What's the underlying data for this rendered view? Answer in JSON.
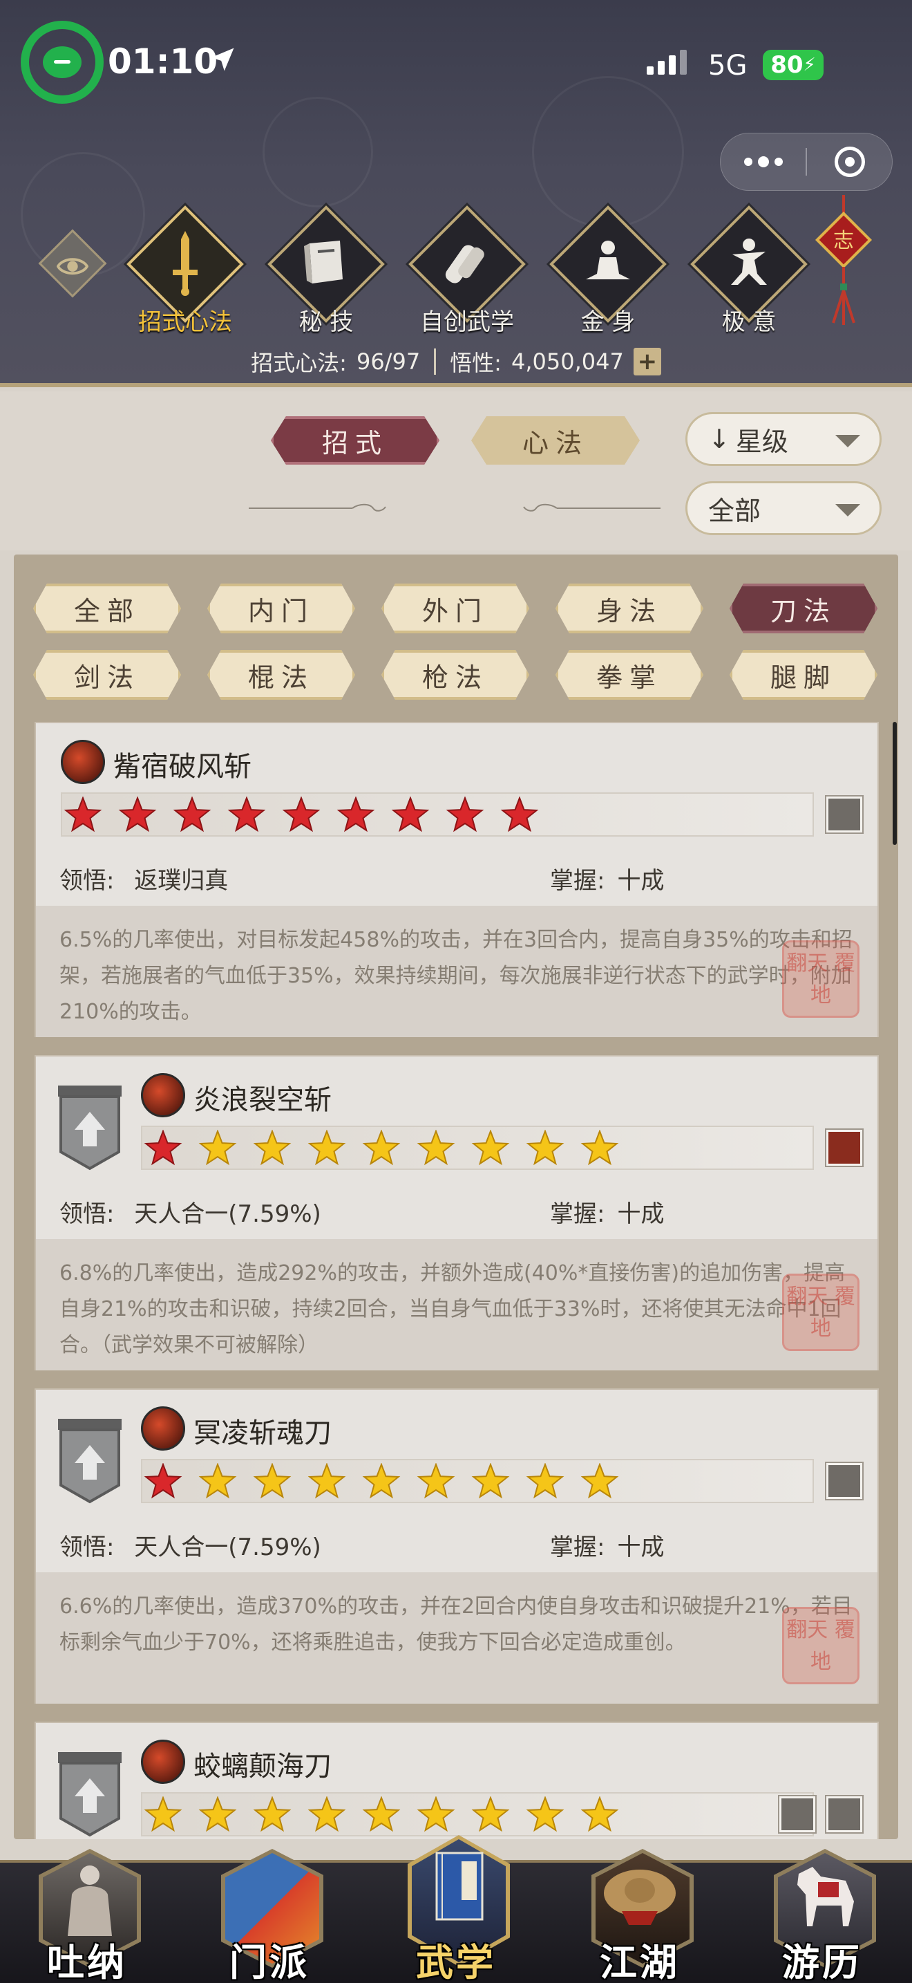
{
  "status": {
    "time": "01:10",
    "network": "5G",
    "battery": "80"
  },
  "top_tabs": [
    {
      "label": "招式心法",
      "icon": "sword-icon",
      "active": true
    },
    {
      "label": "秘 技",
      "icon": "book-icon",
      "active": false
    },
    {
      "label": "自创武学",
      "icon": "scroll-icon",
      "active": false
    },
    {
      "label": "金 身",
      "icon": "meditation-icon",
      "active": false
    },
    {
      "label": "极 意",
      "icon": "martial-stance-icon",
      "active": false
    }
  ],
  "knot_char": "志",
  "stats": {
    "moves_label": "招式心法:",
    "moves_value": "96/97",
    "insight_label": "悟性:",
    "insight_value": "4,050,047",
    "plus": "+"
  },
  "mode_tabs": {
    "zhaoshi": "招式",
    "xinfa": "心法"
  },
  "sort": {
    "label": "星级",
    "arrow": "↓"
  },
  "scope": {
    "label": "全部"
  },
  "filters": [
    {
      "label": "全部",
      "active": false
    },
    {
      "label": "内门",
      "active": false
    },
    {
      "label": "外门",
      "active": false
    },
    {
      "label": "身法",
      "active": false
    },
    {
      "label": "刀法",
      "active": true
    },
    {
      "label": "剑法",
      "active": false
    },
    {
      "label": "棍法",
      "active": false
    },
    {
      "label": "枪法",
      "active": false
    },
    {
      "label": "拳掌",
      "active": false
    },
    {
      "label": "腿脚",
      "active": false
    }
  ],
  "skills": [
    {
      "name": "觜宿破风斩",
      "stars_total": 9,
      "red_stars": 9,
      "insight_label": "领悟:",
      "insight": "返璞归真",
      "mastery_label": "掌握:",
      "mastery": "十成",
      "desc": "6.5%的几率使出，对目标发起458%的攻击，并在3回合内，提高自身35%的攻击和招架，若施展者的气血低于35%，效果持续期间，每次施展非逆行状态下的武学时，附加210%的攻击。",
      "seal": "翻天 覆地"
    },
    {
      "name": "炎浪裂空斩",
      "stars_total": 9,
      "red_stars": 1,
      "insight_label": "领悟:",
      "insight": "天人合一(7.59%)",
      "mastery_label": "掌握:",
      "mastery": "十成",
      "desc": "6.8%的几率使出，造成292%的攻击，并额外造成(40%*直接伤害)的追加伤害，提高自身21%的攻击和识破，持续2回合，当自身气血低于33%时，还将使其无法命中1回合。（武学效果不可被解除）",
      "seal": "翻天 覆地"
    },
    {
      "name": "冥凌斩魂刀",
      "stars_total": 9,
      "red_stars": 1,
      "insight_label": "领悟:",
      "insight": "天人合一(7.59%)",
      "mastery_label": "掌握:",
      "mastery": "十成",
      "desc": "6.6%的几率使出，造成370%的攻击，并在2回合内使自身攻击和识破提升21%，若目标剩余气血少于70%，还将乘胜追击，使我方下回合必定造成重创。",
      "seal": "翻天 覆地"
    },
    {
      "name": "蛟螭颠海刀",
      "stars_total": 9,
      "red_stars": 0
    }
  ],
  "bottom_nav": [
    {
      "label": "吐纳",
      "active": false
    },
    {
      "label": "门派",
      "active": false
    },
    {
      "label": "武学",
      "active": true
    },
    {
      "label": "江湖",
      "active": false
    },
    {
      "label": "游历",
      "active": false
    }
  ],
  "colors": {
    "accent_gold": "#f4c23a",
    "active_chip": "#6e3a42",
    "battery_green": "#2fc54a"
  }
}
